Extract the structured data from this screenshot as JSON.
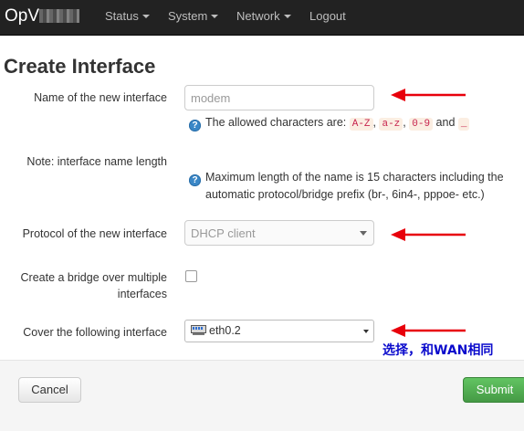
{
  "navbar": {
    "brand": "OpV",
    "items": [
      {
        "label": "Status",
        "has_caret": true
      },
      {
        "label": "System",
        "has_caret": true
      },
      {
        "label": "Network",
        "has_caret": true
      },
      {
        "label": "Logout",
        "has_caret": false
      }
    ]
  },
  "page": {
    "title": "Create Interface"
  },
  "form": {
    "name_label": "Name of the new interface",
    "name_value": "modem",
    "name_help_prefix": "The allowed characters are: ",
    "name_help_codes": [
      "A-Z",
      "a-z",
      "0-9",
      "_"
    ],
    "name_help_sep1": ", ",
    "name_help_sep2": ", ",
    "name_help_and": " and ",
    "note_label": "Note: interface name length",
    "note_help_line1": "Maximum length of the name is 15 characters including the",
    "note_help_line2": "automatic protocol/bridge prefix (br-, 6in4-, pppoe- etc.)",
    "protocol_label": "Protocol of the new interface",
    "protocol_value": "DHCP client",
    "bridge_label_line1": "Create a bridge over multiple",
    "bridge_label_line2": "interfaces",
    "bridge_checked": false,
    "cover_label": "Cover the following interface",
    "cover_value": "eth0.2"
  },
  "annotation": {
    "text": "选择，和WAN相同",
    "arrow_color": "#e8000b",
    "text_color": "#0a0acc"
  },
  "footer": {
    "cancel_label": "Cancel",
    "submit_label": "Submit"
  },
  "colors": {
    "navbar_bg": "#222222",
    "submit_green": "#5cb85c",
    "help_icon_blue": "#3a87c7"
  },
  "icons": [
    "help-icon",
    "network-port-icon",
    "red-arrow"
  ]
}
